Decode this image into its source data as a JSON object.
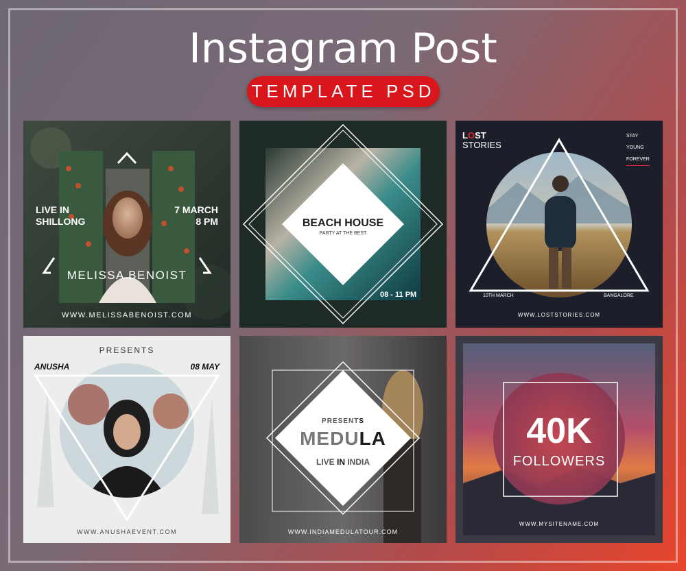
{
  "header": {
    "title": "Instagram Post",
    "subtitle": "TEMPLATE PSD"
  },
  "posts": [
    {
      "left_text": [
        "LIVE IN",
        "SHILLONG"
      ],
      "right_text": [
        "7 MARCH",
        "8 PM"
      ],
      "name": "MELISSA BENOIST",
      "url": "WWW.MELISSABENOIST.COM"
    },
    {
      "title": "BEACH HOUSE",
      "subtitle": "PARTY AT THE BEST",
      "time": "08 - 11 PM"
    },
    {
      "brand_lo": "L",
      "brand_o": "O",
      "brand_st": "ST",
      "brand_line2": "STORIES",
      "menu": [
        "STAY",
        "YOUNG",
        "FOREVER"
      ],
      "date": "10TH MARCH",
      "place": "BANGALORE",
      "url": "WWW.LOSTSTORIES.COM"
    },
    {
      "presents": "PRESENTS",
      "name": "ANUSHA",
      "date": "08 MAY",
      "url": "WWW.ANUSHAEVENT.COM"
    },
    {
      "presents_a": "PRESENT",
      "presents_b": "S",
      "title_a": "MEDU",
      "title_b": "LA",
      "tagline_a": "LIVE ",
      "tagline_b": "IN",
      "tagline_c": " INDIA",
      "url": "WWW.INDIAMEDULATOUR.COM"
    },
    {
      "big": "40K",
      "label": "FOLLOWERS",
      "url": "WWW.MYSITENAME.COM"
    }
  ],
  "colors": {
    "accent_red": "#d8161b",
    "brand_red": "#e0262b"
  }
}
